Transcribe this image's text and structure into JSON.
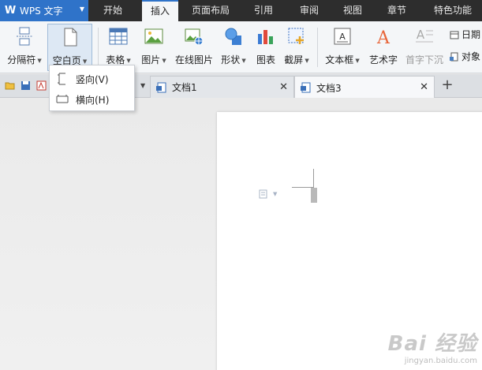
{
  "app": {
    "logo_glyph": "W",
    "name": "WPS 文字"
  },
  "menu_tabs": [
    "开始",
    "插入",
    "页面布局",
    "引用",
    "审阅",
    "视图",
    "章节",
    "特色功能"
  ],
  "active_menu_tab": "插入",
  "ribbon": {
    "section_break": "分隔符",
    "blank_page": "空白页",
    "table": "表格",
    "picture": "图片",
    "online_picture": "在线图片",
    "shape": "形状",
    "chart": "图表",
    "screenshot": "截屏",
    "textbox": "文本框",
    "wordart": "艺术字",
    "drop_cap": "首字下沉",
    "date": "日期",
    "object": "对象"
  },
  "blank_page_menu": {
    "portrait": "竖向(V)",
    "landscape": "横向(H)"
  },
  "tabs": [
    {
      "name": "文档1",
      "close": "✕"
    },
    {
      "name": "文档3",
      "close": "✕"
    }
  ],
  "add_tab": "+",
  "watermark": {
    "logo": "Bai 经验",
    "url": "jingyan.baidu.com"
  },
  "colors": {
    "accent": "#2f73c9",
    "titlebar": "#2d2d2d",
    "ribbon": "#f4f6f8"
  }
}
